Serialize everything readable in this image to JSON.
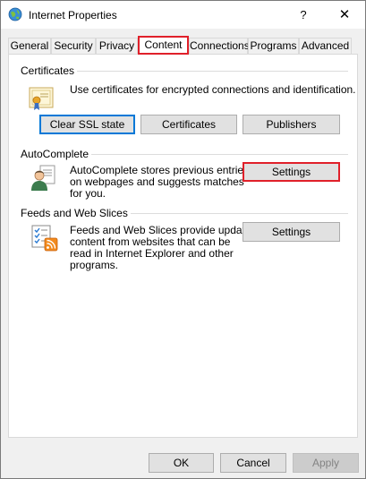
{
  "window": {
    "title": "Internet Properties",
    "help_glyph": "?",
    "close_glyph": "✕"
  },
  "tabs": [
    {
      "label": "General",
      "active": false
    },
    {
      "label": "Security",
      "active": false
    },
    {
      "label": "Privacy",
      "active": false
    },
    {
      "label": "Content",
      "active": true
    },
    {
      "label": "Connections",
      "active": false
    },
    {
      "label": "Programs",
      "active": false
    },
    {
      "label": "Advanced",
      "active": false
    }
  ],
  "certificates": {
    "heading": "Certificates",
    "description": "Use certificates for encrypted connections and identification.",
    "buttons": {
      "clear_ssl": "Clear SSL state",
      "certificates": "Certificates",
      "publishers": "Publishers"
    },
    "icon": "certificate-icon"
  },
  "autocomplete": {
    "heading": "AutoComplete",
    "description_lines": [
      "AutoComplete stores previous entries",
      "on webpages and suggests matches",
      "for you."
    ],
    "settings_label": "Settings",
    "icon": "autocomplete-user-icon"
  },
  "feeds": {
    "heading": "Feeds and Web Slices",
    "description_lines": [
      "Feeds and Web Slices provide updated",
      "content from websites that can be",
      "read in Internet Explorer and other",
      "programs."
    ],
    "settings_label": "Settings",
    "icon": "feed-list-icon"
  },
  "footer": {
    "ok": "OK",
    "cancel": "Cancel",
    "apply": "Apply"
  },
  "colors": {
    "highlight_red": "#e0202a",
    "focus_blue": "#0078d7"
  }
}
